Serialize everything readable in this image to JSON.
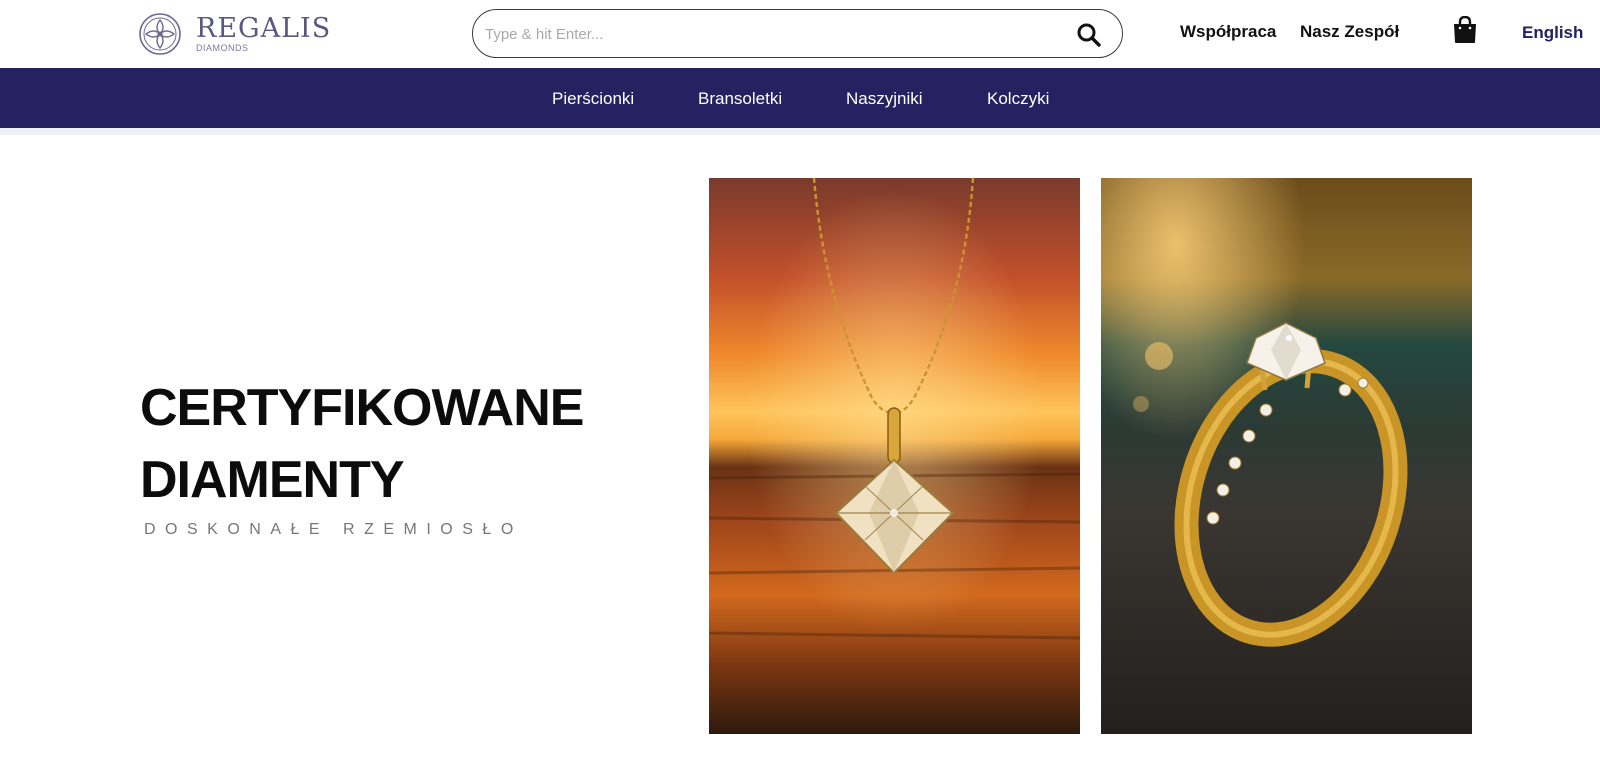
{
  "header": {
    "logo": {
      "word": "REGALIS",
      "sub": "DIAMONDS",
      "icon": "logo-emblem-icon"
    },
    "search": {
      "placeholder": "Type & hit Enter...",
      "value": "",
      "icon": "search-icon"
    },
    "links": [
      {
        "label": "Współpraca"
      },
      {
        "label": "Nasz Zespół"
      }
    ],
    "cart_icon": "shopping-bag-icon",
    "language": "English"
  },
  "nav": {
    "items": [
      {
        "label": "Pierścionki"
      },
      {
        "label": "Bransoletki"
      },
      {
        "label": "Naszyjniki"
      },
      {
        "label": "Kolczyki"
      }
    ]
  },
  "hero": {
    "title_line1": "CERTYFIKOWANE",
    "title_line2": "DIAMENTY",
    "subtitle": "DOSKONAŁE RZEMIOSŁO"
  },
  "images": [
    {
      "subject": "diamond-pendant-necklace-sunset"
    },
    {
      "subject": "diamond-gold-ring-on-stone"
    }
  ],
  "colors": {
    "brand_navy": "#262262",
    "text": "#111111",
    "subtitle_gray": "#777777",
    "logo_purple": "#5a5880"
  }
}
